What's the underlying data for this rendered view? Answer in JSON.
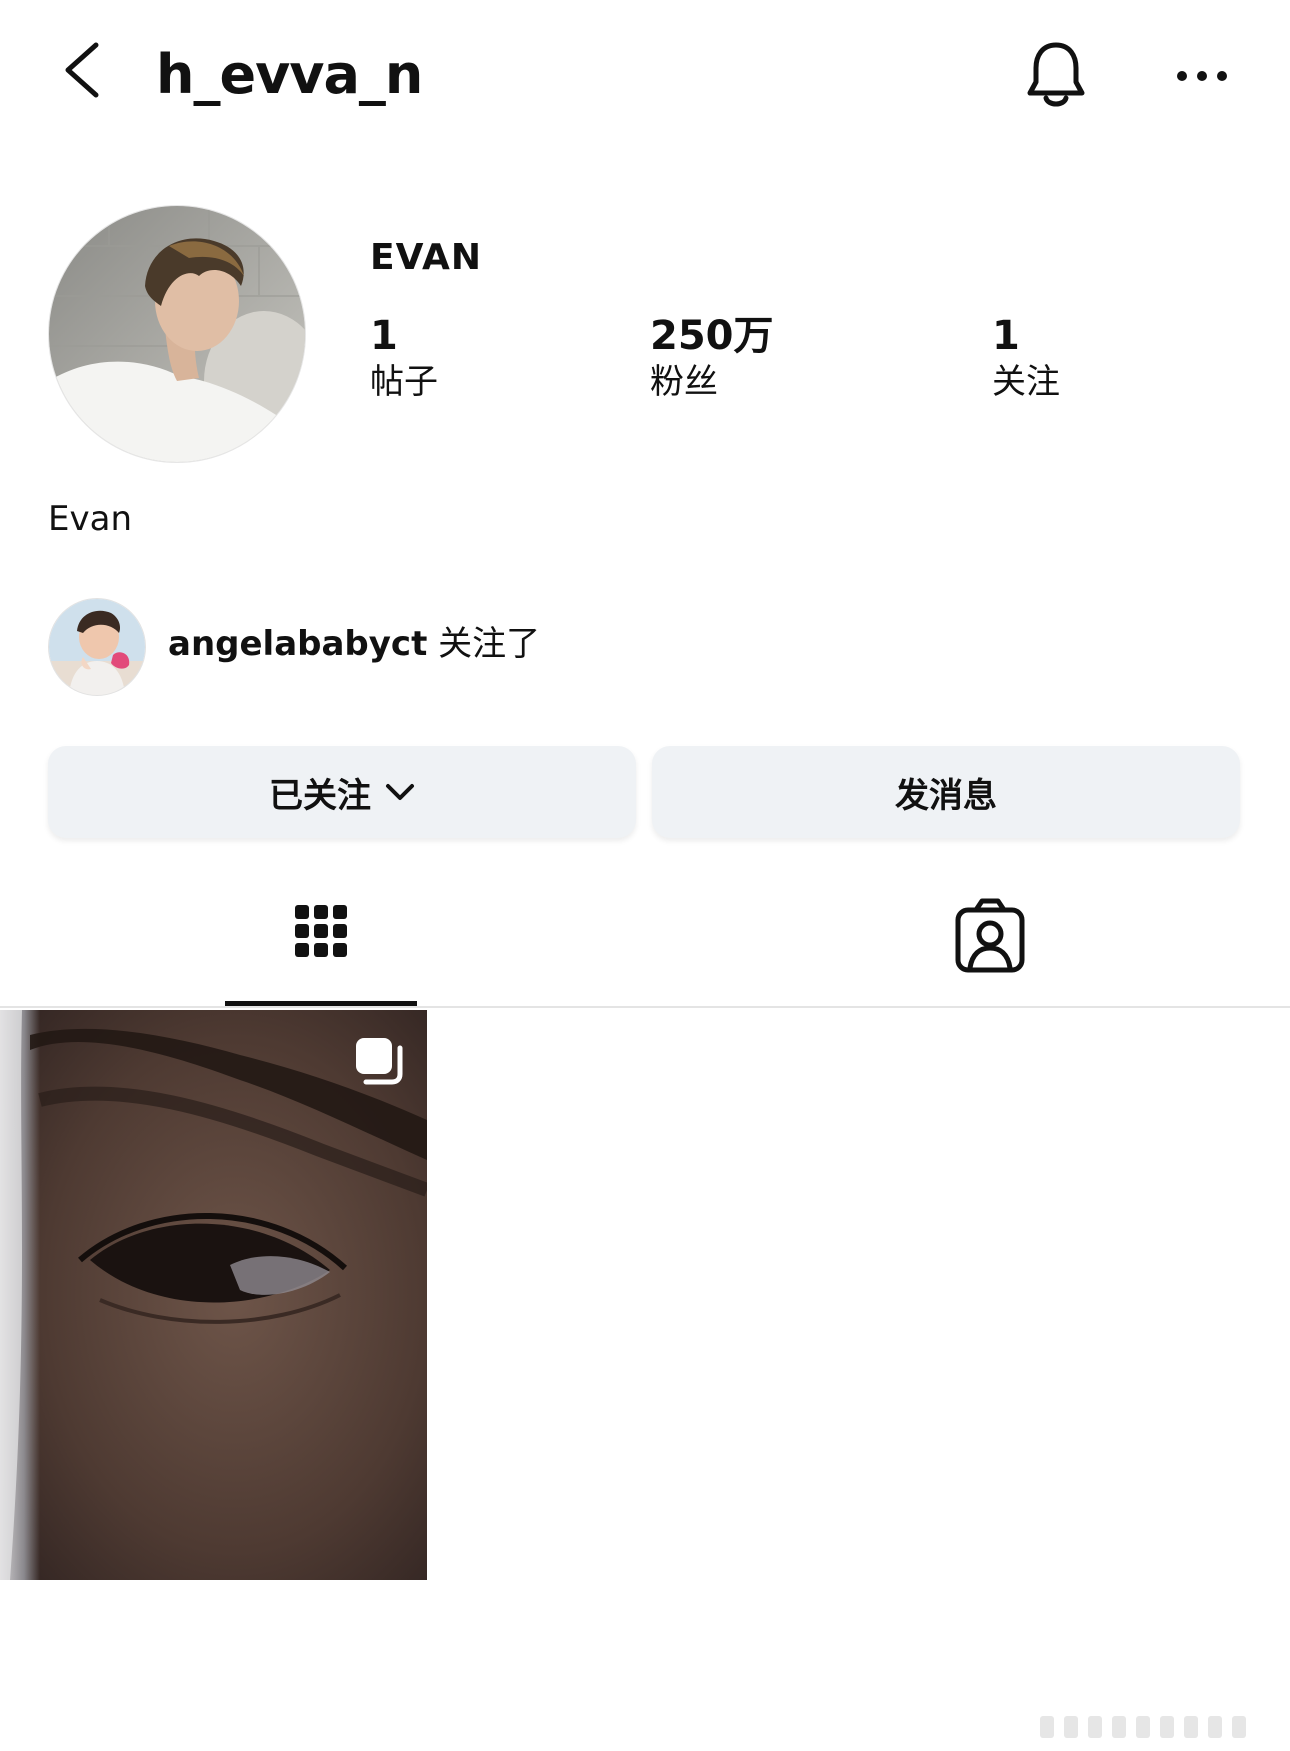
{
  "header": {
    "username": "h_evva_n",
    "back_icon": "chevron-left-icon",
    "bell_icon": "bell-icon",
    "more_icon": "more-horizontal-icon"
  },
  "profile": {
    "display_name": "EVAN",
    "bio": "Evan",
    "stats": {
      "posts": {
        "value": "1",
        "label": "帖子"
      },
      "followers": {
        "value": "250万",
        "label": "粉丝"
      },
      "following": {
        "value": "1",
        "label": "关注"
      }
    }
  },
  "followed_by": {
    "username": "angelababyct",
    "suffix": "关注了"
  },
  "actions": {
    "following_label": "已关注",
    "message_label": "发消息"
  },
  "tabs": {
    "grid_icon": "grid-icon",
    "tagged_icon": "tagged-person-icon",
    "active": "grid"
  },
  "posts": [
    {
      "type": "carousel",
      "badge_icon": "multiple-posts-icon"
    }
  ]
}
